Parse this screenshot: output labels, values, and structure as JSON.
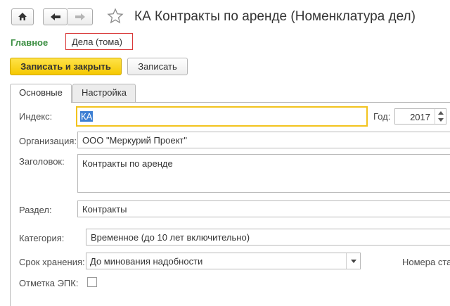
{
  "window": {
    "title": "КА Контракты по аренде (Номенклатура дел)",
    "home_icon": "home-icon",
    "back_icon": "arrow-left-icon",
    "forward_icon": "arrow-right-icon",
    "favorite_icon": "star-icon"
  },
  "nav": {
    "main": "Главное",
    "deals": "Дела (тома)"
  },
  "toolbar": {
    "save_close": "Записать и закрыть",
    "save": "Записать"
  },
  "tabs": {
    "main": "Основные",
    "settings": "Настройка"
  },
  "form": {
    "index_label": "Индекс:",
    "index_value": "КА",
    "year_label": "Год:",
    "year_value": "2017",
    "org_label": "Организация:",
    "org_value": "ООО \"Меркурий Проект\"",
    "heading_label": "Заголовок:",
    "heading_value": "Контракты по аренде",
    "section_label": "Раздел:",
    "section_value": "Контракты",
    "category_label": "Категория:",
    "category_value": "Временное (до 10 лет включительно)",
    "storage_label": "Срок хранения:",
    "storage_value": "До минования надобности",
    "numbers_label": "Номера ста",
    "epk_label": "Отметка ЭПК:"
  },
  "colors": {
    "accent_yellow": "#f5c800",
    "nav_green": "#3a8e41",
    "highlight_red": "#d93a3a",
    "focus_yellow": "#f2c31e"
  }
}
